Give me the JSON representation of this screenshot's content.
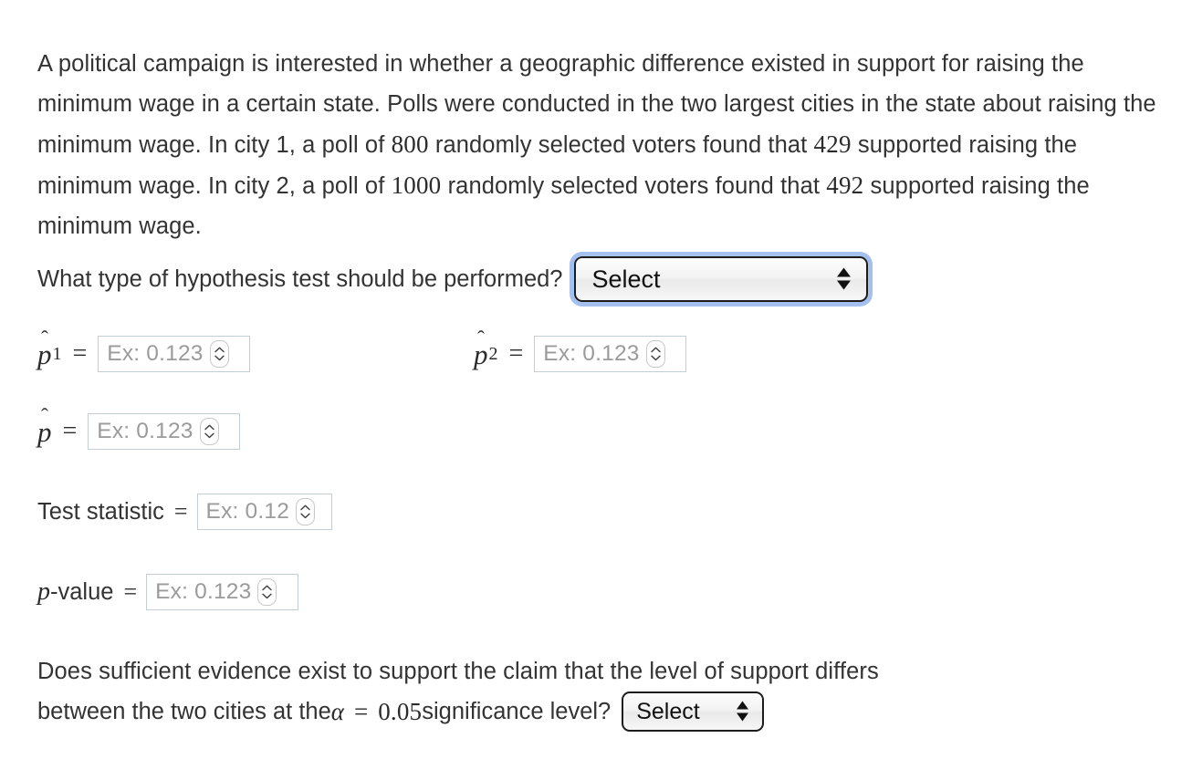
{
  "problem": {
    "text_part_1": "A political campaign is interested in whether a geographic difference existed in support for raising the minimum wage in a certain state. Polls were conducted in the two largest cities in the state about raising the minimum wage. In city 1, a poll of ",
    "sample_size_1": "800",
    "text_part_2": " randomly selected voters found that ",
    "successes_1": "429",
    "text_part_3": " supported raising the minimum wage. In city 2, a poll of ",
    "sample_size_2": "1000",
    "text_part_4": " randomly selected voters found that ",
    "successes_2": "492",
    "text_part_5": " supported raising the minimum wage."
  },
  "hypothesis_question": {
    "prompt": "What type of hypothesis test should be performed?",
    "select_value": "Select"
  },
  "fields": {
    "p_hat_1": {
      "symbol": "p",
      "subscript": "1",
      "equals": "=",
      "placeholder": "Ex: 0.123"
    },
    "p_hat_2": {
      "symbol": "p",
      "subscript": "2",
      "equals": "=",
      "placeholder": "Ex: 0.123"
    },
    "p_hat_pooled": {
      "symbol": "p",
      "equals": "=",
      "placeholder": "Ex: 0.123"
    },
    "test_statistic": {
      "label": "Test statistic",
      "equals": "=",
      "placeholder": "Ex: 0.12"
    },
    "p_value": {
      "label_italic": "p",
      "label_rest": "-value",
      "equals": "=",
      "placeholder": "Ex: 0.123"
    }
  },
  "conclusion_question": {
    "line_1": "Does sufficient evidence exist to support the claim that the level of support differs",
    "line_2_before": "between the two cities at the ",
    "alpha_symbol": "α",
    "alpha_equals": "=",
    "alpha_value": "0.05",
    "line_2_after": " significance level?",
    "select_value": "Select"
  },
  "colors": {
    "text": "#333333",
    "placeholder": "#9b9b9b",
    "input_border": "#c3cdd4",
    "select_border": "#1c1c1c",
    "focus_ring": "#a3c0ef",
    "background": "#ffffff"
  }
}
